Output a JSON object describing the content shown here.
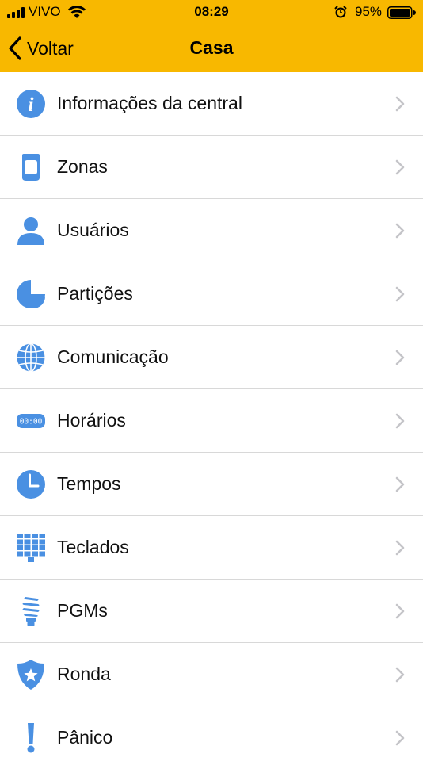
{
  "status_bar": {
    "carrier": "VIVO",
    "time": "08:29",
    "battery": "95%",
    "icons": [
      "signal-icon",
      "wifi-icon",
      "alarm-icon",
      "battery-icon"
    ]
  },
  "nav": {
    "back_label": "Voltar",
    "title": "Casa"
  },
  "colors": {
    "header": "#f8b800",
    "icon_blue": "#4a90e2",
    "chevron": "#c4c4c8",
    "separator": "#d8d8d8"
  },
  "menu": [
    {
      "label": "Informações da central",
      "icon": "info-icon"
    },
    {
      "label": "Zonas",
      "icon": "sensor-icon"
    },
    {
      "label": "Usuários",
      "icon": "user-icon"
    },
    {
      "label": "Partições",
      "icon": "partition-icon"
    },
    {
      "label": "Comunicação",
      "icon": "globe-icon"
    },
    {
      "label": "Horários",
      "icon": "clock-display-icon",
      "icon_text": "00:00"
    },
    {
      "label": "Tempos",
      "icon": "clock-icon"
    },
    {
      "label": "Teclados",
      "icon": "keypad-icon"
    },
    {
      "label": "PGMs",
      "icon": "bulb-icon"
    },
    {
      "label": "Ronda",
      "icon": "shield-star-icon"
    },
    {
      "label": "Pânico",
      "icon": "exclamation-icon"
    }
  ]
}
